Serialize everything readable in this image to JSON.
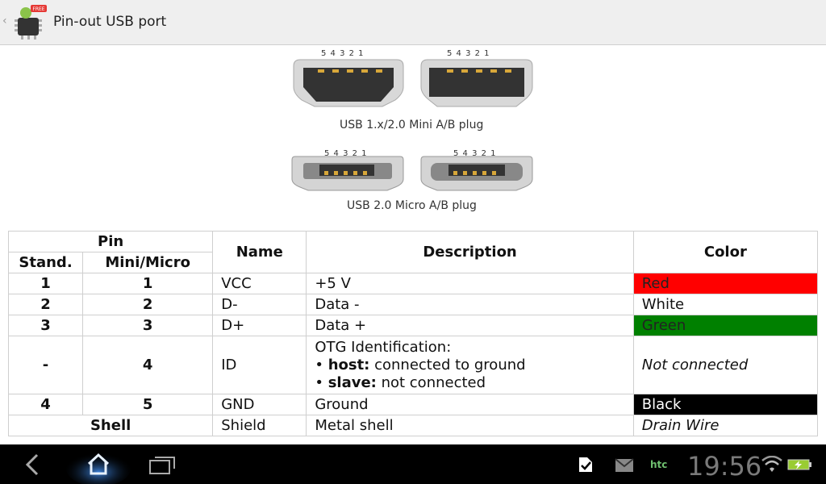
{
  "app": {
    "title": "Pin-out USB port",
    "icon_badge": "FREE"
  },
  "figures": {
    "mini_caption": "USB 1.x/2.0 Mini A/B plug",
    "micro_caption": "USB 2.0 Micro A/B plug",
    "pin_numbers": "5 4 3 2 1"
  },
  "table": {
    "header": {
      "pin": "Pin",
      "stand": "Stand.",
      "mini_micro": "Mini/Micro",
      "name": "Name",
      "description": "Description",
      "color": "Color"
    },
    "rows": [
      {
        "stand": "1",
        "mini": "1",
        "name": "VCC",
        "desc": "+5 V",
        "color": "Red"
      },
      {
        "stand": "2",
        "mini": "2",
        "name": "D-",
        "desc": "Data -",
        "color": "White"
      },
      {
        "stand": "3",
        "mini": "3",
        "name": "D+",
        "desc": "Data +",
        "color": "Green"
      },
      {
        "stand": "-",
        "mini": "4",
        "name": "ID",
        "desc_title": "OTG Identification:",
        "desc_host_label": "host:",
        "desc_host_text": " connected to ground",
        "desc_slave_label": "slave:",
        "desc_slave_text": " not connected",
        "color": "Not connected"
      },
      {
        "stand": "4",
        "mini": "5",
        "name": "GND",
        "desc": "Ground",
        "color": "Black"
      },
      {
        "shell": "Shell",
        "name": "Shield",
        "desc": "Metal shell",
        "color": "Drain Wire"
      }
    ]
  },
  "statusbar": {
    "time": "19:56",
    "carrier": "htc"
  },
  "colors": {
    "red": "#ff0000",
    "green": "#008000",
    "black": "#000000"
  }
}
